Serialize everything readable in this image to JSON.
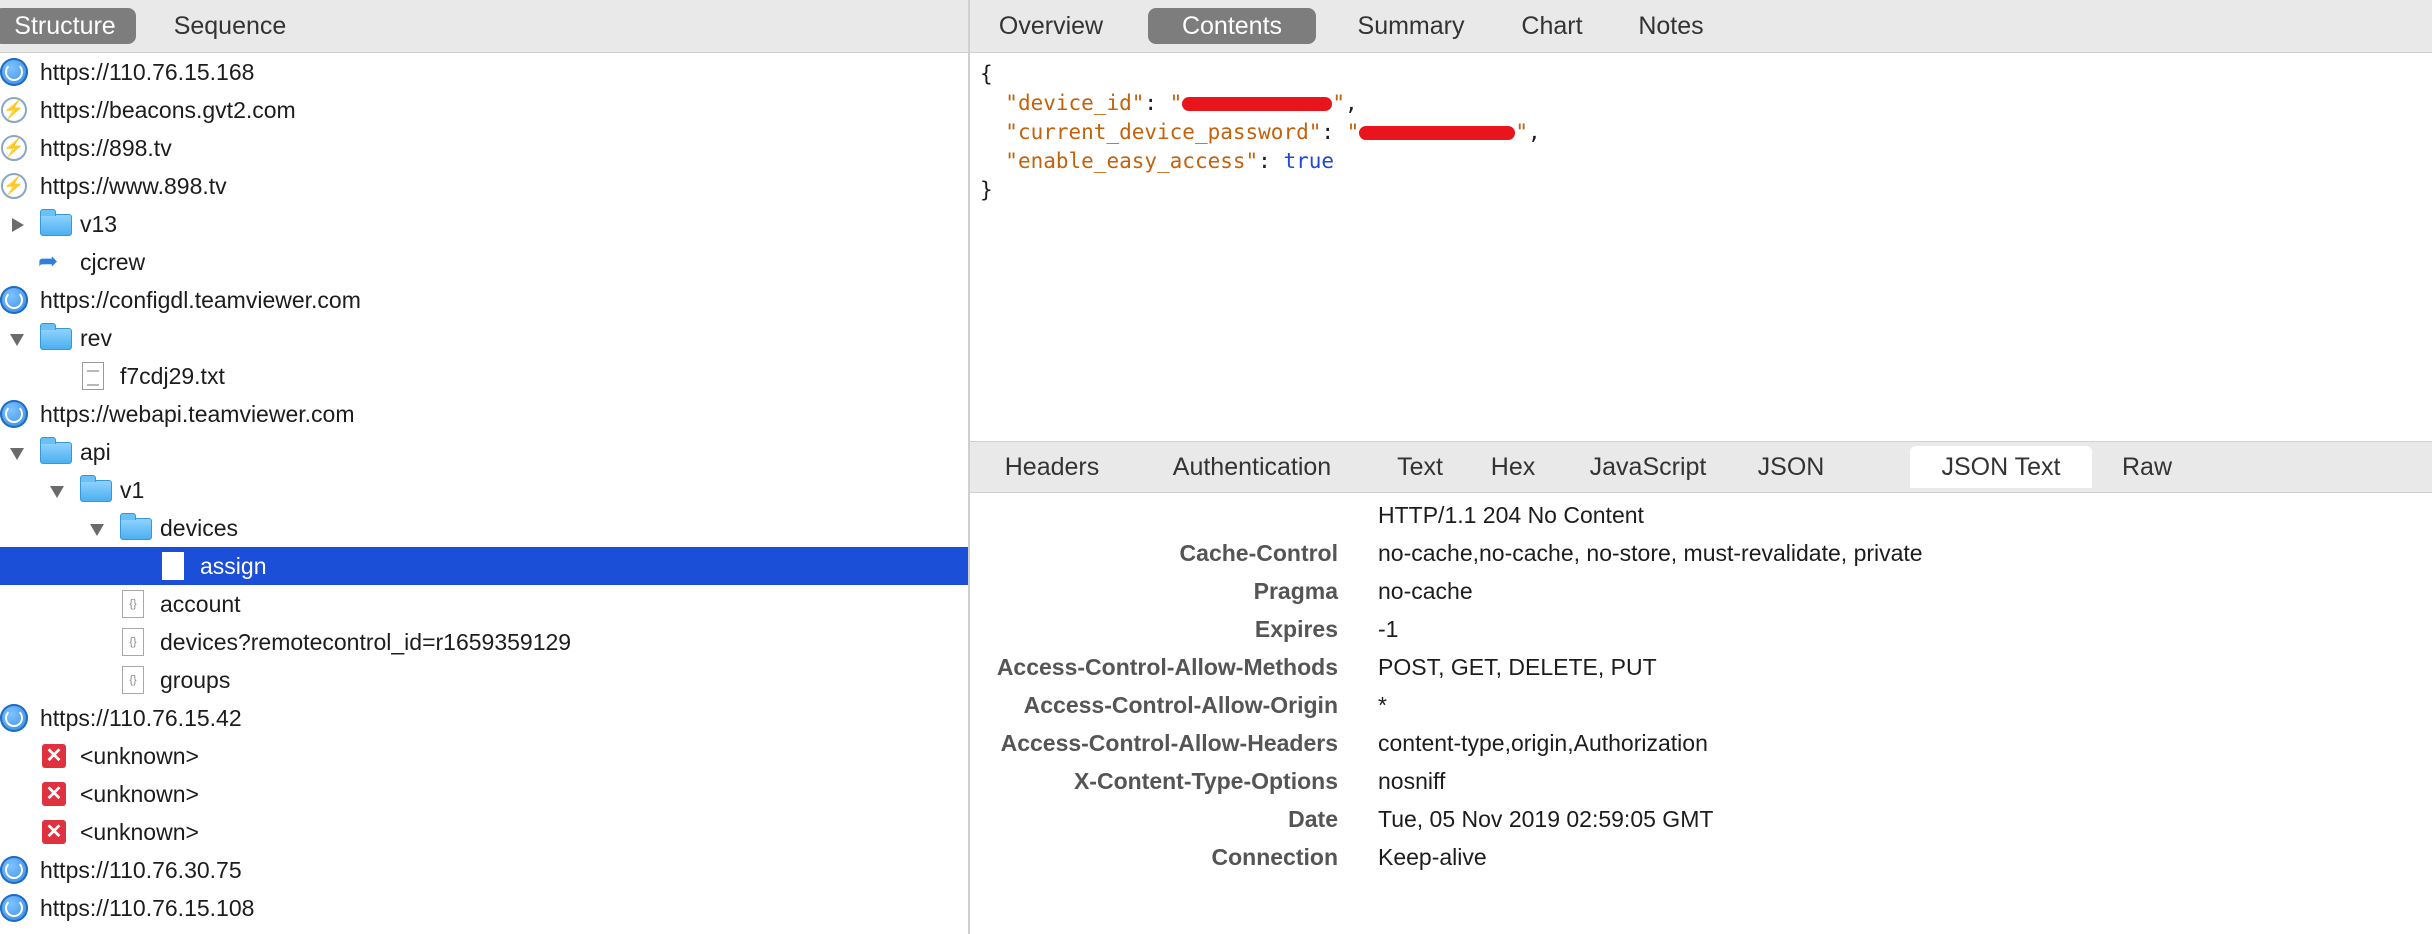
{
  "left_tabs": {
    "structure": "Structure",
    "sequence": "Sequence"
  },
  "tree": [
    {
      "label": "https://110.76.15.168",
      "icon": "globe-icon"
    },
    {
      "label": "https://beacons.gvt2.com",
      "icon": "lightning-icon"
    },
    {
      "label": "https://898.tv",
      "icon": "lightning-icon"
    },
    {
      "label": "https://www.898.tv",
      "icon": "lightning-icon"
    },
    {
      "label": "v13",
      "icon": "folder-icon"
    },
    {
      "label": "cjcrew",
      "icon": "redirect-icon"
    },
    {
      "label": "https://configdl.teamviewer.com",
      "icon": "globe-icon"
    },
    {
      "label": "rev",
      "icon": "folder-icon"
    },
    {
      "label": "f7cdj29.txt",
      "icon": "text-file-icon"
    },
    {
      "label": "https://webapi.teamviewer.com",
      "icon": "globe-icon"
    },
    {
      "label": "api",
      "icon": "folder-icon"
    },
    {
      "label": "v1",
      "icon": "folder-icon"
    },
    {
      "label": "devices",
      "icon": "folder-icon"
    },
    {
      "label": "assign",
      "icon": "document-icon"
    },
    {
      "label": "account",
      "icon": "json-file-icon"
    },
    {
      "label": "devices?remotecontrol_id=r1659359129",
      "icon": "json-file-icon"
    },
    {
      "label": "groups",
      "icon": "json-file-icon"
    },
    {
      "label": "https://110.76.15.42",
      "icon": "globe-icon"
    },
    {
      "label": "<unknown>",
      "icon": "error-icon"
    },
    {
      "label": "<unknown>",
      "icon": "error-icon"
    },
    {
      "label": "<unknown>",
      "icon": "error-icon"
    },
    {
      "label": "https://110.76.30.75",
      "icon": "globe-icon"
    },
    {
      "label": "https://110.76.15.108",
      "icon": "globe-icon"
    }
  ],
  "right_tabs": {
    "overview": "Overview",
    "contents": "Contents",
    "summary": "Summary",
    "chart": "Chart",
    "notes": "Notes"
  },
  "json_body": {
    "open": "{",
    "close": "}",
    "k1": "\"device_id\"",
    "k2": "\"current_device_password\"",
    "k3": "\"enable_easy_access\"",
    "colon": ": ",
    "quote": "\"",
    "comma": ",",
    "v3": "true"
  },
  "lower_tabs": {
    "headers": "Headers",
    "authentication": "Authentication",
    "text": "Text",
    "hex": "Hex",
    "javascript": "JavaScript",
    "json": "JSON",
    "json_text": "JSON Text",
    "raw": "Raw"
  },
  "response": {
    "status_line": "HTTP/1.1 204 No Content",
    "headers": [
      {
        "name": "Cache-Control",
        "value": "no-cache,no-cache, no-store, must-revalidate, private"
      },
      {
        "name": "Pragma",
        "value": "no-cache"
      },
      {
        "name": "Expires",
        "value": "-1"
      },
      {
        "name": "Access-Control-Allow-Methods",
        "value": "POST, GET, DELETE, PUT"
      },
      {
        "name": "Access-Control-Allow-Origin",
        "value": "*"
      },
      {
        "name": "Access-Control-Allow-Headers",
        "value": "content-type,origin,Authorization"
      },
      {
        "name": "X-Content-Type-Options",
        "value": "nosniff"
      },
      {
        "name": "Date",
        "value": "Tue, 05 Nov 2019 02:59:05 GMT"
      },
      {
        "name": "Connection",
        "value": "Keep-alive"
      }
    ]
  },
  "colors": {
    "selection": "#1c4fd8",
    "json_key": "#c4620b",
    "json_bool": "#1f48d6",
    "redaction": "#e8161c"
  }
}
